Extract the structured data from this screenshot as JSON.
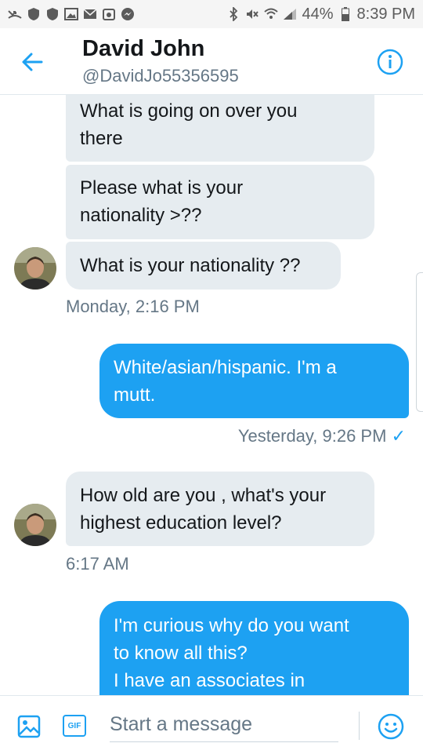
{
  "status_bar": {
    "battery": "44%",
    "time": "8:39 PM"
  },
  "header": {
    "name": "David John",
    "handle": "@DavidJo55356595"
  },
  "messages": [
    {
      "dir": "received",
      "text": "What is going on over you\nthere"
    },
    {
      "dir": "received",
      "text": "Please what is your\nnationality >??"
    },
    {
      "dir": "received",
      "text": "What is your nationality ??"
    },
    {
      "kind": "timestamp",
      "text": "Monday, 2:16 PM"
    },
    {
      "dir": "sent",
      "text": "White/asian/hispanic. I'm a\nmutt."
    },
    {
      "kind": "timestamp",
      "text": "Yesterday, 9:26 PM",
      "status": "✓"
    },
    {
      "dir": "received",
      "text": "How old are you , what's your\nhighest education level?"
    },
    {
      "kind": "timestamp",
      "text": "6:17 AM"
    },
    {
      "dir": "sent",
      "text": "I'm curious why do you want\nto know all this?\nI have an associates in"
    }
  ],
  "composer": {
    "gif_label": "GIF",
    "placeholder": "Start a message"
  },
  "colors": {
    "accent": "#1da1f2",
    "received_bubble": "#e6ecf0",
    "secondary_text": "#657786"
  },
  "icons": [
    "back-arrow-icon",
    "info-icon",
    "avatar",
    "image-icon",
    "gif-icon",
    "emoji-icon"
  ]
}
